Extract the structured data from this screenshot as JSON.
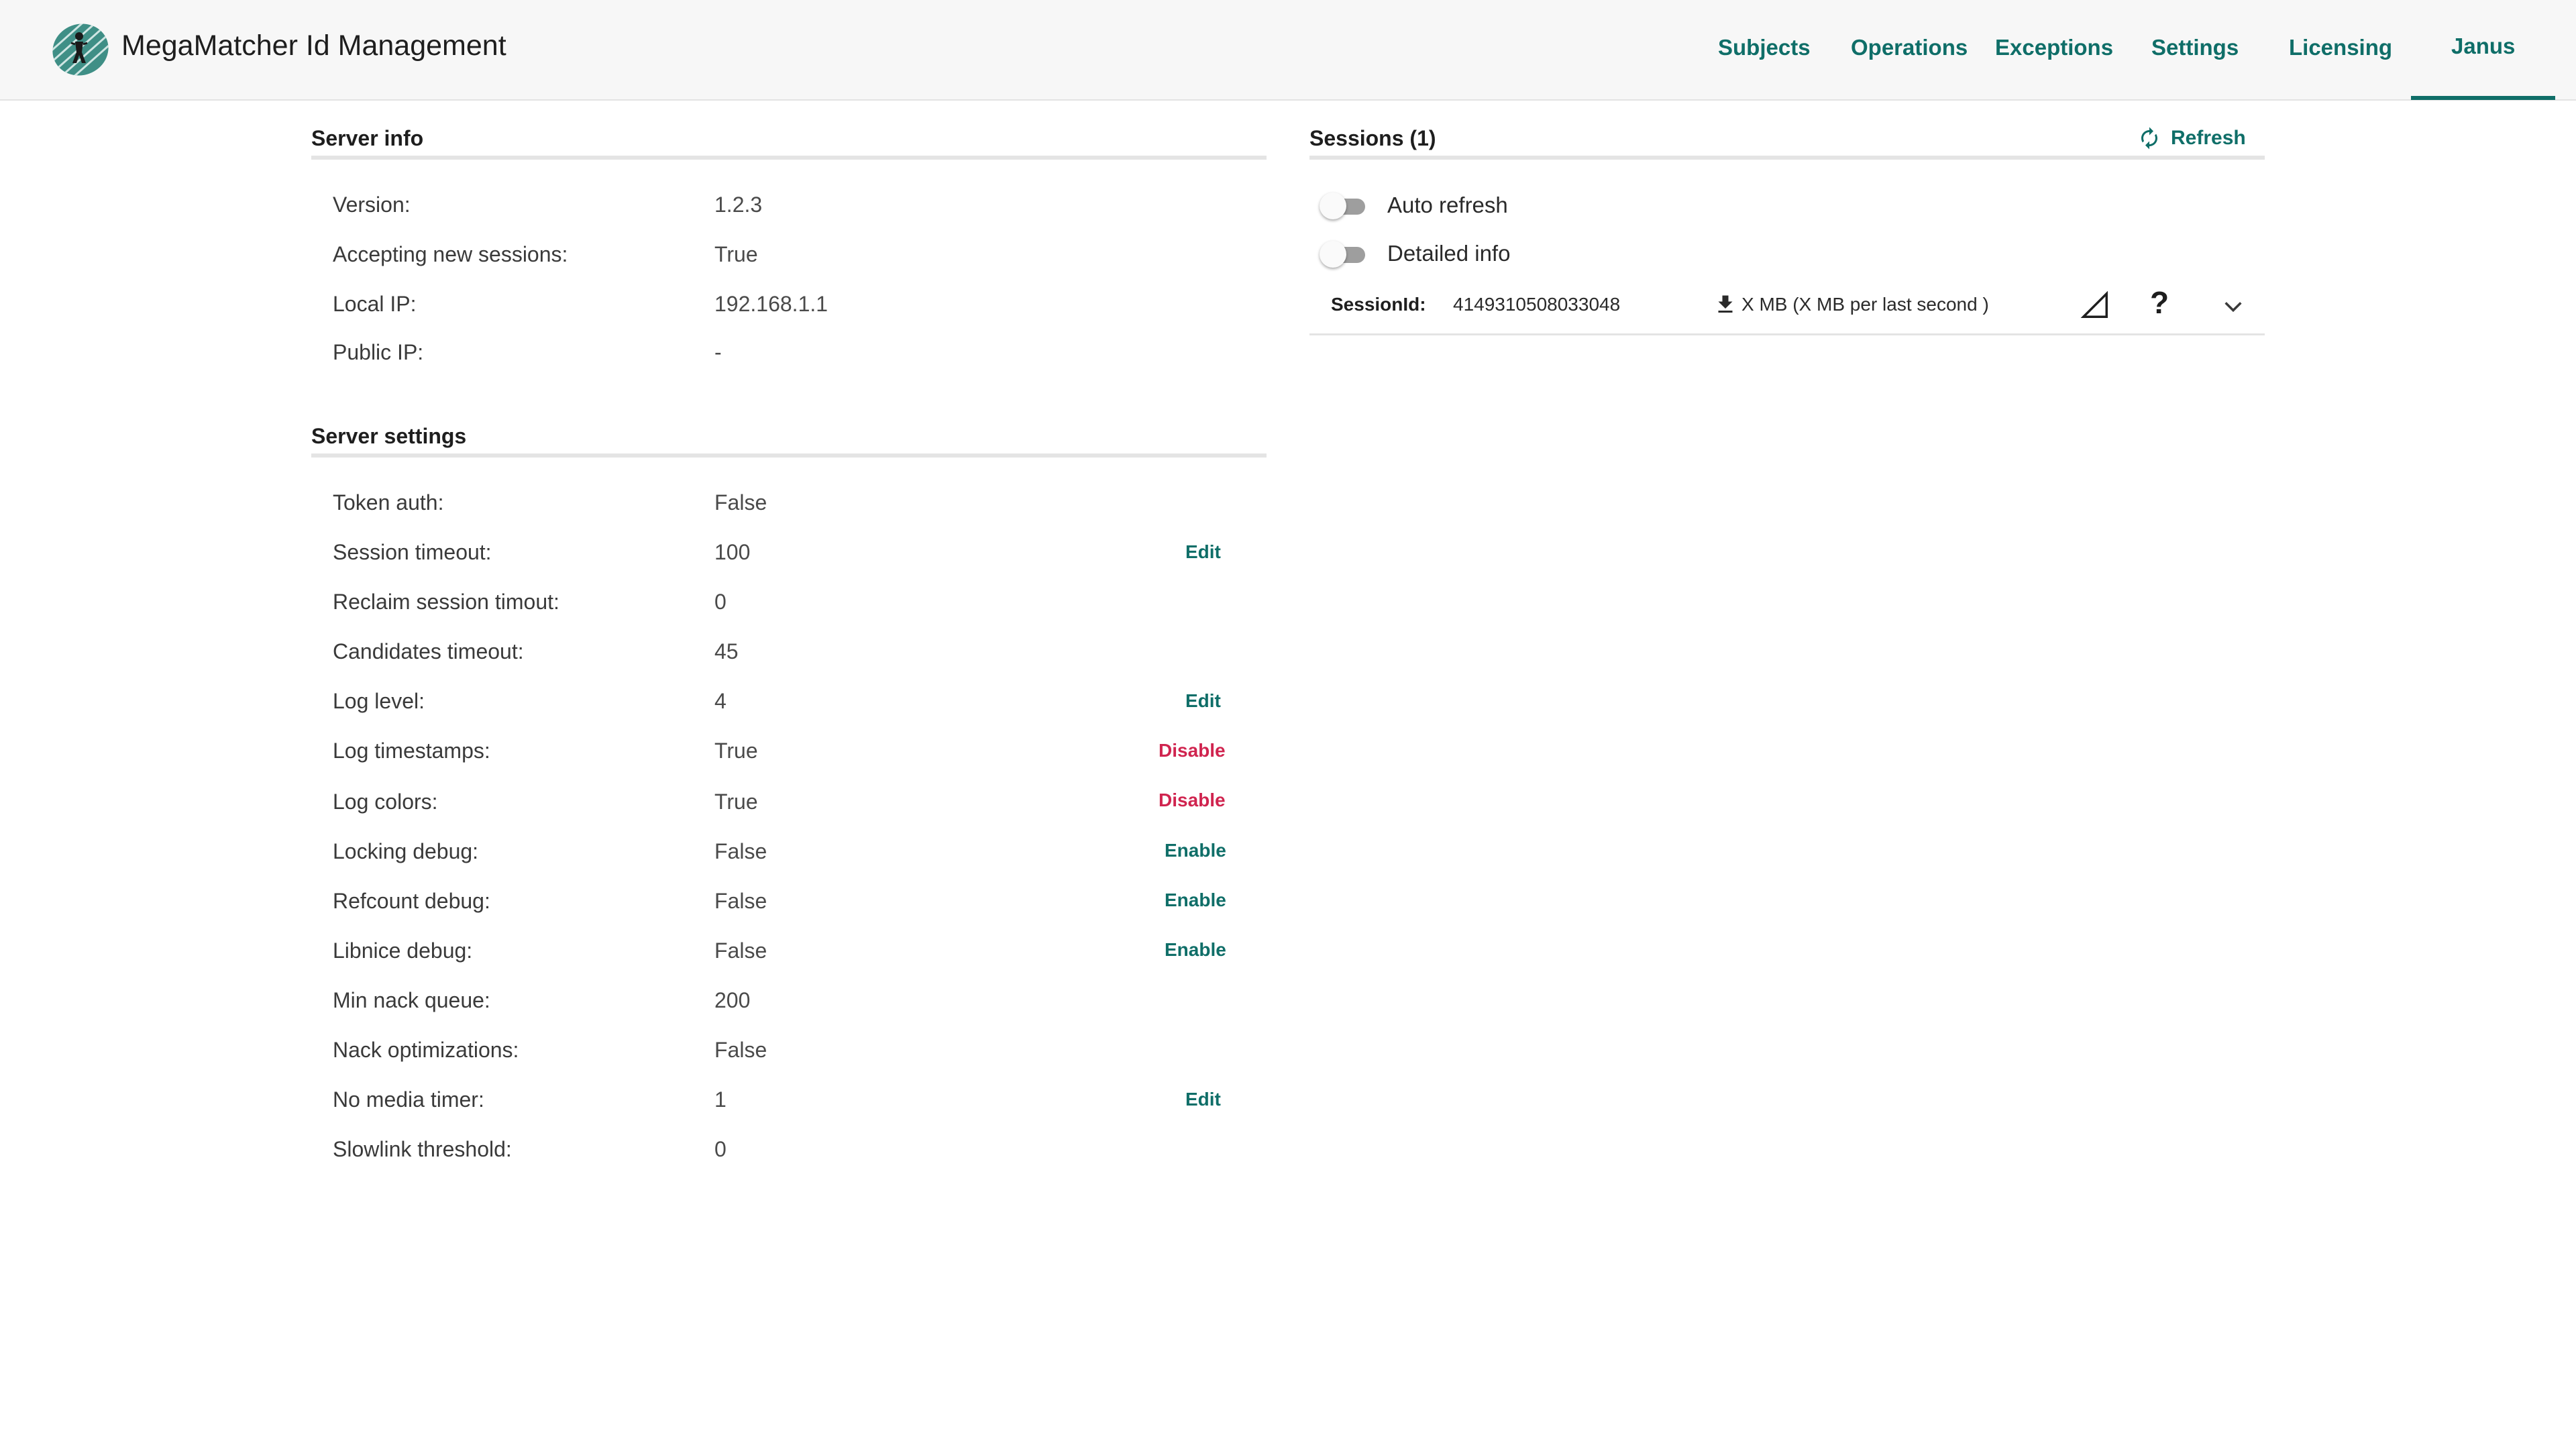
{
  "header": {
    "title": "MegaMatcher Id Management",
    "nav": [
      "Subjects",
      "Operations",
      "Exceptions",
      "Settings",
      "Licensing",
      "Janus"
    ],
    "active_nav": "Janus",
    "accent_color": "#0f6e68"
  },
  "server_info": {
    "title": "Server info",
    "rows": [
      {
        "label": "Version:",
        "value": "1.2.3"
      },
      {
        "label": "Accepting new sessions:",
        "value": "True"
      },
      {
        "label": "Local IP:",
        "value": "192.168.1.1"
      },
      {
        "label": "Public IP:",
        "value": "-"
      }
    ]
  },
  "server_settings": {
    "title": "Server settings",
    "rows": [
      {
        "label": "Token auth:",
        "value": "False",
        "action": ""
      },
      {
        "label": "Session timeout:",
        "value": "100",
        "action": "Edit"
      },
      {
        "label": "Reclaim session timout:",
        "value": "0",
        "action": ""
      },
      {
        "label": "Candidates timeout:",
        "value": "45",
        "action": ""
      },
      {
        "label": "Log level:",
        "value": "4",
        "action": "Edit"
      },
      {
        "label": "Log timestamps:",
        "value": "True",
        "action": "Disable"
      },
      {
        "label": "Log colors:",
        "value": "True",
        "action": "Disable"
      },
      {
        "label": "Locking debug:",
        "value": "False",
        "action": "Enable"
      },
      {
        "label": "Refcount debug:",
        "value": "False",
        "action": "Enable"
      },
      {
        "label": "Libnice debug:",
        "value": "False",
        "action": "Enable"
      },
      {
        "label": "Min nack queue:",
        "value": "200",
        "action": ""
      },
      {
        "label": "Nack optimizations:",
        "value": "False",
        "action": ""
      },
      {
        "label": "No media timer:",
        "value": "1",
        "action": "Edit"
      },
      {
        "label": "Slowlink threshold:",
        "value": "0",
        "action": ""
      }
    ],
    "disable_color": "#d0244f"
  },
  "sessions": {
    "title": "Sessions (1)",
    "refresh_label": "Refresh",
    "auto_refresh_label": "Auto refresh",
    "auto_refresh_on": false,
    "detailed_info_label": "Detailed info",
    "detailed_info_on": false,
    "session": {
      "key_label": "SessionId:",
      "id": "4149310508033048",
      "size": "X MB (X MB per last second )",
      "icons": [
        "download-icon",
        "signal-icon",
        "help-icon",
        "chevron-down-icon"
      ]
    }
  }
}
